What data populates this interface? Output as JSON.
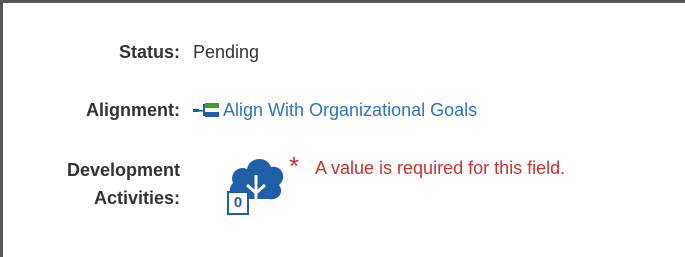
{
  "fields": {
    "status": {
      "label": "Status:",
      "value": "Pending"
    },
    "alignment": {
      "label": "Alignment:",
      "link_text": "Align With Organizational Goals",
      "icon": "org-chart-icon"
    },
    "development_activities": {
      "label_line1": "Development",
      "label_line2": "Activities:",
      "count": "0",
      "icon": "cloud-upload-icon",
      "required_marker": "*",
      "error": "A value is required for this field."
    }
  },
  "colors": {
    "link": "#2f73c8",
    "error": "#c8322f",
    "cloud": "#1f5fa8",
    "org_icon_green": "#4a9a3a"
  }
}
